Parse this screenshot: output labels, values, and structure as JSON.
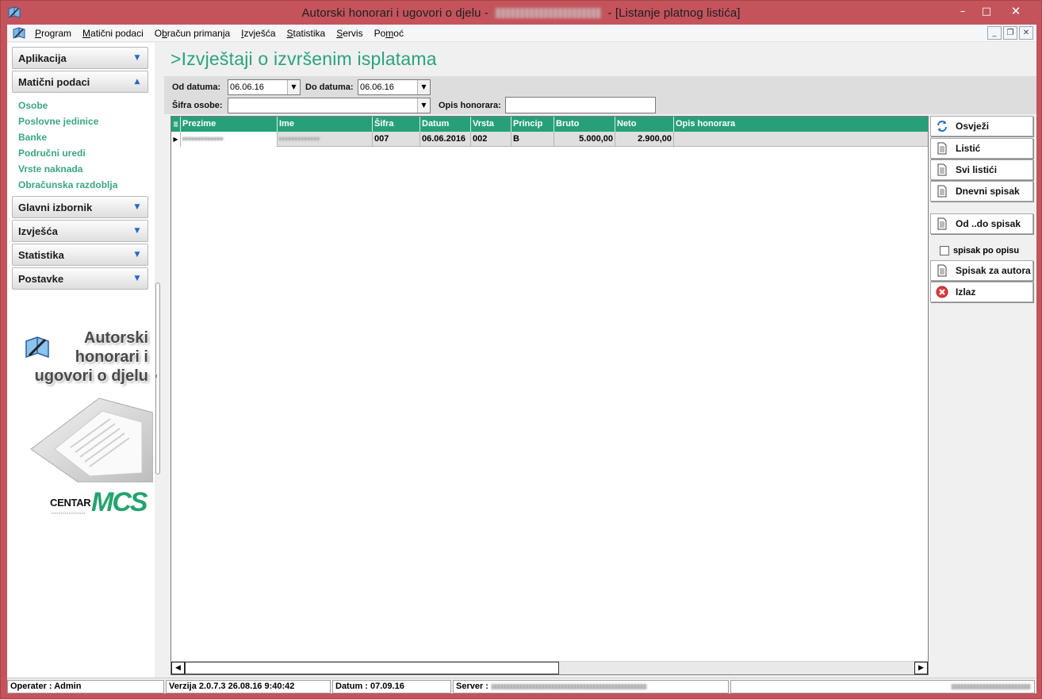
{
  "window": {
    "title_prefix": "Autorski honorari i ugovori o djelu - ",
    "title_suffix": " - [Listanje platnog listića]",
    "controls": {
      "minimize": "–",
      "maximize": "□",
      "close": "✕"
    }
  },
  "menu": {
    "items": [
      {
        "prefix": "",
        "key": "P",
        "rest": "rogram"
      },
      {
        "prefix": "",
        "key": "M",
        "rest": "atični podaci"
      },
      {
        "prefix": "O",
        "key": "b",
        "rest": "račun primanja"
      },
      {
        "prefix": "",
        "key": "I",
        "rest": "zvješća"
      },
      {
        "prefix": "",
        "key": "S",
        "rest": "tatistika"
      },
      {
        "prefix": "",
        "key": "S",
        "rest": "ervis"
      },
      {
        "prefix": "Po",
        "key": "m",
        "rest": "oć"
      }
    ],
    "mdi": {
      "minimize": "_",
      "restore": "❐",
      "close": "✕"
    }
  },
  "nav": {
    "sections": [
      {
        "label": "Aplikacija",
        "expanded": false
      },
      {
        "label": "Matični podaci",
        "expanded": true
      },
      {
        "label": "Glavni izbornik",
        "expanded": false
      },
      {
        "label": "Izvješća",
        "expanded": false
      },
      {
        "label": "Statistika",
        "expanded": false
      },
      {
        "label": "Postavke",
        "expanded": false
      }
    ],
    "sub_items": [
      "Osobe",
      "Poslovne jedinice",
      "Banke",
      "Područni uredi",
      "Vrste naknada",
      "Obračunska razdoblja"
    ],
    "brand_lines": [
      "Autorski",
      "honorari i",
      "ugovori o djelu"
    ],
    "logo": {
      "word": "CENTAR",
      "mark": "MCS"
    },
    "splitter_arrow": "‹"
  },
  "main": {
    "title": ">Izvještaji o izvršenim isplatama",
    "filters": {
      "od_label": "Od datuma:",
      "od_value": "06.06.16",
      "do_label": "Do datuma:",
      "do_value": "06.06.16",
      "sifra_label": "Šifra osobe:",
      "sifra_value": "",
      "opis_label": "Opis honorara:",
      "opis_value": ""
    },
    "grid": {
      "columns": [
        "Prezime",
        "Ime",
        "Šifra",
        "Datum",
        "Vrsta",
        "Princip",
        "Bruto",
        "Neto",
        "Opis honorara"
      ],
      "rows": [
        {
          "prezime": "",
          "ime": "",
          "sifra": "007",
          "datum": "06.06.2016",
          "vrsta": "002",
          "princip": "B",
          "bruto": "5.000,00",
          "neto": "2.900,00",
          "opis": ""
        }
      ]
    },
    "actions": {
      "osvjezi": "Osvježi",
      "listic": "Listić",
      "svi_listici": "Svi listići",
      "dnevni_spisak": "Dnevni spisak",
      "od_do_spisak": "Od ..do spisak",
      "spisak_po_opisu": "spisak po opisu",
      "spisak_za_autora": "Spisak za autora",
      "izlaz": "Izlaz"
    }
  },
  "status": {
    "operater": "Operater :  Admin",
    "verzija": "Verzija 2.0.7.3    26.08.16 9:40:42",
    "datum": "Datum  :  07.09.16",
    "server_label": "Server :"
  },
  "colors": {
    "accent": "#27a07a",
    "title_green": "#2aa37f",
    "nav_link": "#3aa683",
    "window_frame": "#c4535c"
  }
}
